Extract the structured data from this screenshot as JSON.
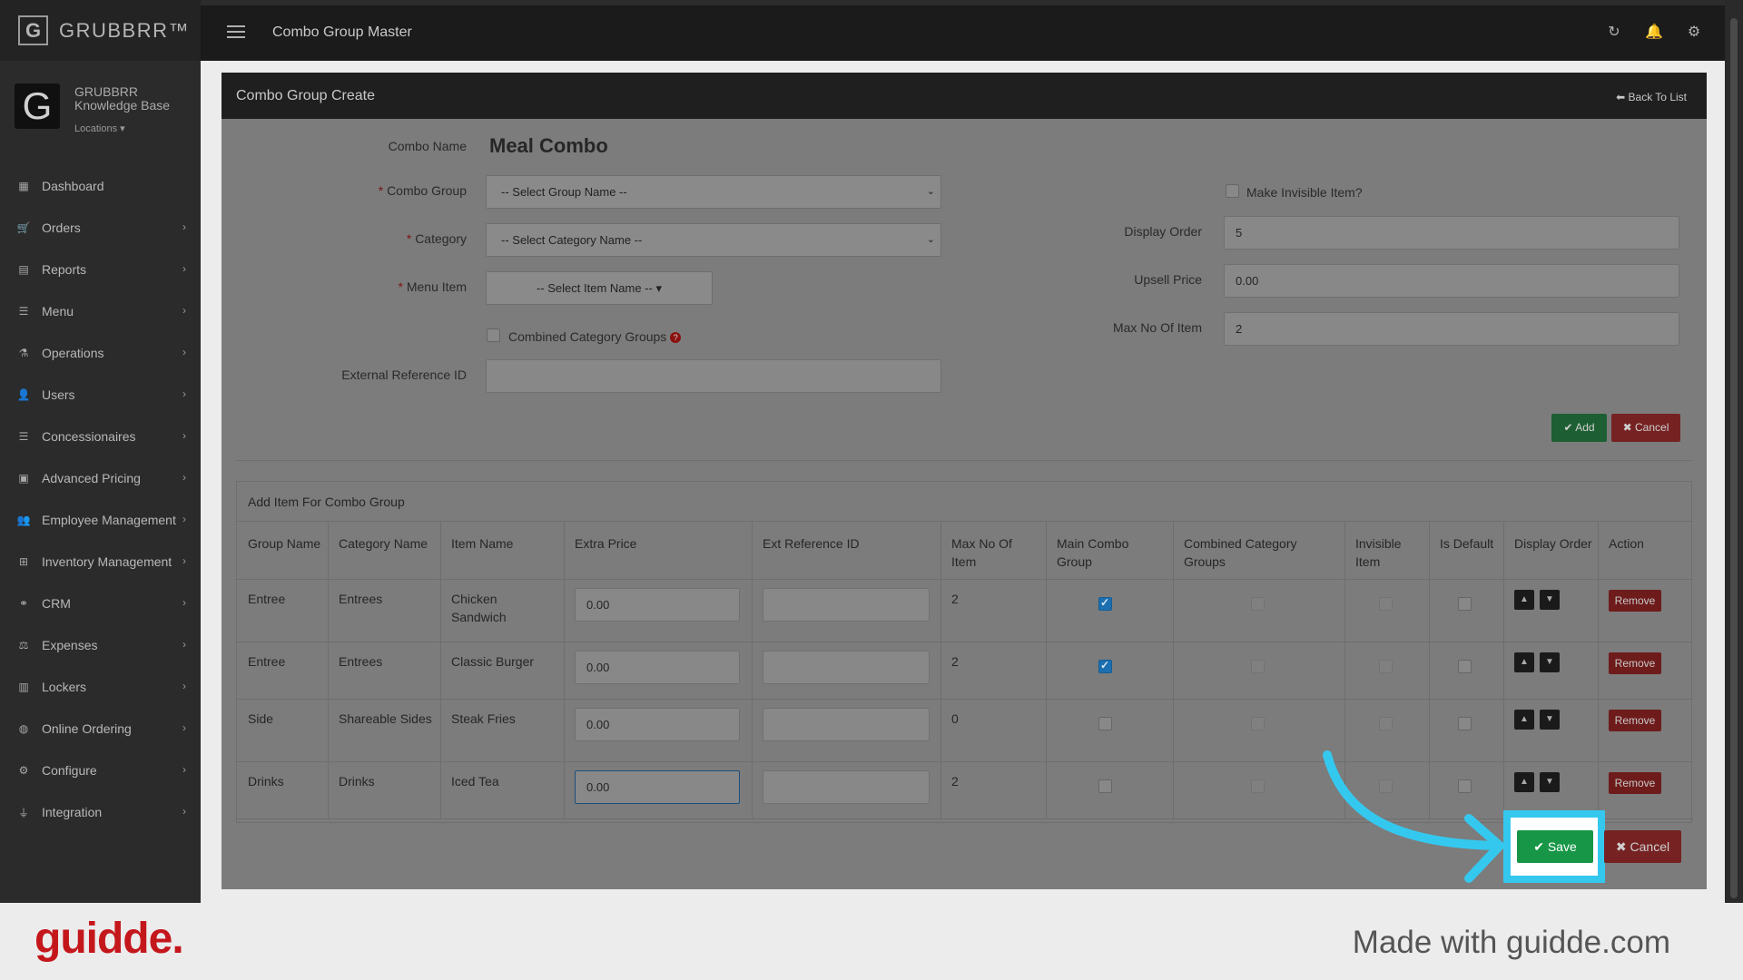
{
  "app": {
    "logo": "G",
    "brand": "GRUBBRR™",
    "page_title": "Combo Group Master"
  },
  "profile": {
    "name": "GRUBBRR Knowledge Base",
    "locations": "Locations ▾"
  },
  "sidebar": {
    "items": [
      {
        "label": "Dashboard",
        "icon": "dashboard-icon",
        "glyph": "▦",
        "chevron": ""
      },
      {
        "label": "Orders",
        "icon": "cart-icon",
        "glyph": "🛒",
        "chevron": "›"
      },
      {
        "label": "Reports",
        "icon": "report-icon",
        "glyph": "▤",
        "chevron": "›"
      },
      {
        "label": "Menu",
        "icon": "menu-list-icon",
        "glyph": "☰",
        "chevron": "›"
      },
      {
        "label": "Operations",
        "icon": "flask-icon",
        "glyph": "⚗",
        "chevron": "›"
      },
      {
        "label": "Users",
        "icon": "users-icon",
        "glyph": "👤",
        "chevron": "›"
      },
      {
        "label": "Concessionaires",
        "icon": "list-icon",
        "glyph": "☰",
        "chevron": "›"
      },
      {
        "label": "Advanced Pricing",
        "icon": "money-icon",
        "glyph": "▣",
        "chevron": "›"
      },
      {
        "label": "Employee Management",
        "icon": "group-icon",
        "glyph": "👥",
        "chevron": "›"
      },
      {
        "label": "Inventory Management",
        "icon": "sitemap-icon",
        "glyph": "⊞",
        "chevron": "›"
      },
      {
        "label": "CRM",
        "icon": "link-icon",
        "glyph": "⚭",
        "chevron": "›"
      },
      {
        "label": "Expenses",
        "icon": "scale-icon",
        "glyph": "⚖",
        "chevron": "›"
      },
      {
        "label": "Lockers",
        "icon": "locker-icon",
        "glyph": "▥",
        "chevron": "›"
      },
      {
        "label": "Online Ordering",
        "icon": "globe-icon",
        "glyph": "◍",
        "chevron": "›"
      },
      {
        "label": "Configure",
        "icon": "gear-icon",
        "glyph": "⚙",
        "chevron": "›"
      },
      {
        "label": "Integration",
        "icon": "plug-icon",
        "glyph": "⏚",
        "chevron": "›"
      }
    ]
  },
  "panel": {
    "title": "Combo Group Create",
    "back": "Back To List"
  },
  "form": {
    "combo_name_label": "Combo Name",
    "combo_name_value": "Meal Combo",
    "combo_group_label": "Combo Group",
    "combo_group_value": "-- Select Group Name --",
    "category_label": "Category",
    "category_value": "-- Select Category Name --",
    "menu_item_label": "Menu Item",
    "menu_item_value": "-- Select Item Name --",
    "combined_label": "Combined Category Groups",
    "ext_ref_label": "External Reference ID",
    "ext_ref_value": "",
    "invisible_label": "Make Invisible Item?",
    "display_order_label": "Display Order",
    "display_order_value": "5",
    "upsell_label": "Upsell Price",
    "upsell_value": "0.00",
    "max_items_label": "Max No Of Item",
    "max_items_value": "2",
    "add_btn": "Add",
    "cancel_btn": "Cancel"
  },
  "table": {
    "caption": "Add Item For Combo Group",
    "headers": [
      "Group Name",
      "Category Name",
      "Item Name",
      "Extra Price",
      "Ext Reference ID",
      "Max No Of Item",
      "Main Combo Group",
      "Combined Category Groups",
      "Invisible Item",
      "Is Default",
      "Display Order",
      "Action"
    ],
    "rows": [
      {
        "group": "Entree",
        "category": "Entrees",
        "item": "Chicken Sandwich",
        "price": "0.00",
        "ext": "",
        "max": "2",
        "main": true,
        "remove": "Remove"
      },
      {
        "group": "Entree",
        "category": "Entrees",
        "item": "Classic Burger",
        "price": "0.00",
        "ext": "",
        "max": "2",
        "main": true,
        "remove": "Remove"
      },
      {
        "group": "Side",
        "category": "Shareable Sides",
        "item": "Steak Fries",
        "price": "0.00",
        "ext": "",
        "max": "0",
        "main": false,
        "remove": "Remove"
      },
      {
        "group": "Drinks",
        "category": "Drinks",
        "item": "Iced Tea",
        "price": "0.00",
        "ext": "",
        "max": "2",
        "main": false,
        "remove": "Remove"
      }
    ]
  },
  "actions": {
    "save": "Save",
    "cancel": "Cancel"
  },
  "footer": {
    "logo": "guidde.",
    "tagline": "Made with guidde.com"
  },
  "colors": {
    "highlight": "#35c8ef",
    "save_green": "#179647",
    "brand_red": "#c4171c"
  }
}
